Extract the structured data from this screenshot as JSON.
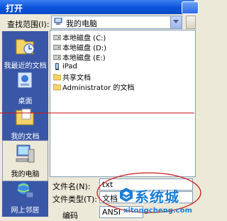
{
  "window": {
    "title": "打开"
  },
  "lookin": {
    "label": "查找范围(I):",
    "value": "我的电脑"
  },
  "places": [
    {
      "label": "我最近的文档",
      "icon": "recent-documents-icon"
    },
    {
      "label": "桌面",
      "icon": "desktop-icon"
    },
    {
      "label": "我的文档",
      "icon": "my-documents-icon"
    },
    {
      "label": "我的电脑",
      "icon": "my-computer-icon",
      "selected": true
    },
    {
      "label": "网上邻居",
      "icon": "network-places-icon"
    }
  ],
  "files": [
    {
      "name": "本地磁盘 (C:)",
      "icon": "local-disk-icon"
    },
    {
      "name": "本地磁盘 (D:)",
      "icon": "local-disk-icon"
    },
    {
      "name": "本地磁盘 (E:)",
      "icon": "local-disk-icon"
    },
    {
      "name": "iPad",
      "icon": "device-icon"
    },
    {
      "name": "共享文档",
      "icon": "folder-icon"
    },
    {
      "name": "Administrator 的文档",
      "icon": "folder-icon"
    }
  ],
  "form": {
    "filename_label": "文件名(N):",
    "filename_value": "txt",
    "filetype_label": "文件类型(T):",
    "filetype_value": "文档",
    "encoding_label": "编码",
    "encoding_value": "ANSI"
  },
  "watermark": {
    "name": "系统城",
    "url": "xitongcheng.com"
  },
  "colors": {
    "titlebar": "#0a52d9",
    "places_bar": "#3a57a7",
    "annotation": "#c81818",
    "watermark": "#1c7ed6"
  }
}
